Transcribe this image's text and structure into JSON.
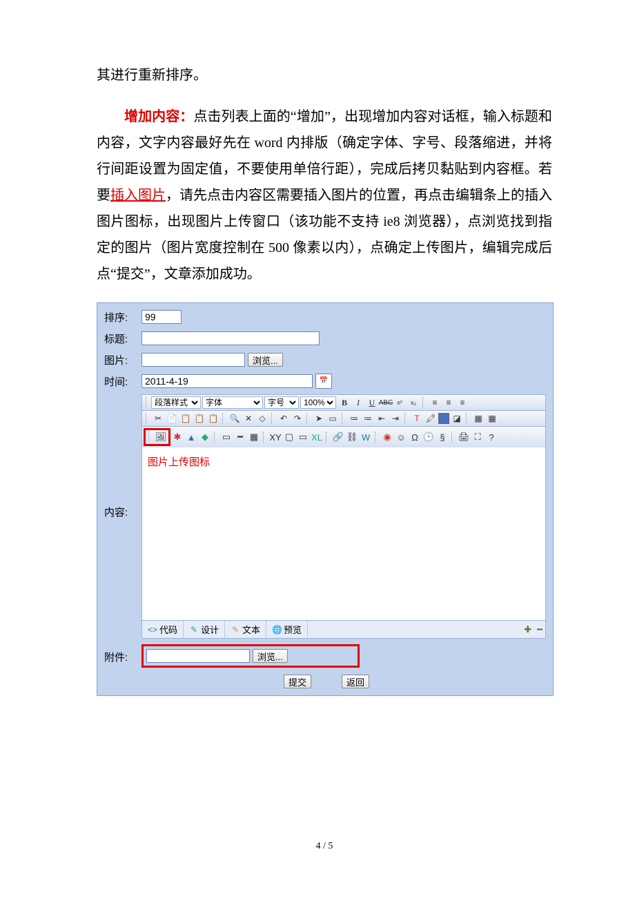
{
  "para1": "其进行重新排序。",
  "para2a": "增加内容：",
  "para2b": "点击列表上面的“增加”，出现增加内容对话框，输入标题和内容，文字内容最好先在 word 内排版（确定字体、字号、段落缩进，并将行间距设置为固定值，不要使用单倍行距），完成后拷贝黏贴到内容框。若要",
  "para2c": "插入图片",
  "para2d": "，请先点击内容区需要插入图片的位置，再点击编辑条上的插入图片图标，出现图片上传窗口（该功能不支持 ie8 浏览器），点浏览找到指定的图片（图片宽度控制在 500 像素以内），点确定上传图片，编辑完成后点“提交”，文章添加成功。",
  "form": {
    "labels": {
      "sort": "排序:",
      "title": "标题:",
      "image": "图片:",
      "time": "时间:",
      "content": "内容:",
      "attach": "附件:"
    },
    "values": {
      "sort": "99",
      "title": "",
      "image_path": "",
      "time": "2011-4-19",
      "attach_path": ""
    },
    "browse": "浏览...",
    "upload_label": "图片上传图标",
    "toolbar": {
      "style": "段落样式",
      "font": "字体",
      "size": "字号",
      "zoom": "100%"
    },
    "tabs": {
      "code": "代码",
      "design": "设计",
      "text": "文本",
      "preview": "预览"
    },
    "submit": "提交",
    "back": "返回"
  },
  "footer": "4 / 5"
}
